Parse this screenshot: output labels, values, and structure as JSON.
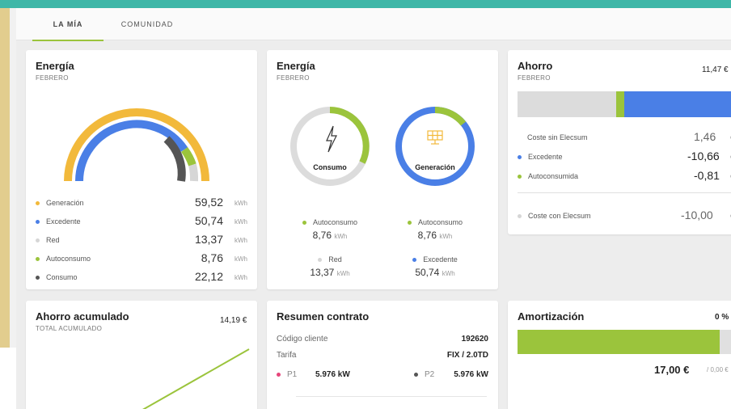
{
  "tabs": [
    {
      "label": "LA MÍA"
    },
    {
      "label": "COMUNIDAD"
    }
  ],
  "energia1": {
    "title": "Energía",
    "subtitle": "FEBRERO",
    "rows": [
      {
        "label": "Generación",
        "value": "59,52",
        "unit": "kWh",
        "color": "#f2b93b"
      },
      {
        "label": "Excedente",
        "value": "50,74",
        "unit": "kWh",
        "color": "#4a7fe6"
      },
      {
        "label": "Red",
        "value": "13,37",
        "unit": "kWh",
        "color": "#d6d6d6"
      },
      {
        "label": "Autoconsumo",
        "value": "8,76",
        "unit": "kWh",
        "color": "#9bc43c"
      },
      {
        "label": "Consumo",
        "value": "22,12",
        "unit": "kWh",
        "color": "#555555"
      }
    ]
  },
  "energia2": {
    "title": "Energía",
    "subtitle": "FEBRERO",
    "consumo_label": "Consumo",
    "generacion_label": "Generación",
    "left": [
      {
        "label": "Autoconsumo",
        "value": "8,76",
        "unit": "kWh",
        "color": "#9bc43c"
      },
      {
        "label": "Red",
        "value": "13,37",
        "unit": "kWh",
        "color": "#d6d6d6"
      }
    ],
    "right": [
      {
        "label": "Autoconsumo",
        "value": "8,76",
        "unit": "kWh",
        "color": "#9bc43c"
      },
      {
        "label": "Excedente",
        "value": "50,74",
        "unit": "kWh",
        "color": "#4a7fe6"
      }
    ]
  },
  "ahorro": {
    "title": "Ahorro",
    "subtitle": "FEBRERO",
    "total": "11,47 €",
    "rows": [
      {
        "label": "Coste sin Elecsum",
        "value": "1,46",
        "unit": "€",
        "color": ""
      },
      {
        "label": "Excedente",
        "value": "-10,66",
        "unit": "€",
        "color": "#4a7fe6"
      },
      {
        "label": "Autoconsumida",
        "value": "-0,81",
        "unit": "€",
        "color": "#9bc43c"
      }
    ],
    "coste_con": {
      "label": "Coste con Elecsum",
      "value": "-10,00",
      "unit": "€",
      "color": "#d6d6d6"
    }
  },
  "ahorro_acumulado": {
    "title": "Ahorro acumulado",
    "subtitle": "TOTAL ACUMULADO",
    "total": "14,19 €"
  },
  "resumen": {
    "title": "Resumen contrato",
    "codigo_label": "Código cliente",
    "codigo_value": "192620",
    "tarifa_label": "Tarifa",
    "tarifa_value": "FIX / 2.0TD",
    "p1_label": "P1",
    "p1_value": "5.976 kW",
    "p2_label": "P2",
    "p2_value": "5.976 kW"
  },
  "amortizacion": {
    "title": "Amortización",
    "percent": "0 %",
    "amount": "17,00 €",
    "of": "/ 0,00 €"
  },
  "colors": {
    "yellow": "#f2b93b",
    "blue": "#4a7fe6",
    "green": "#9bc43c",
    "grey": "#d6d6d6",
    "dark": "#555555",
    "pink": "#e6457a"
  }
}
